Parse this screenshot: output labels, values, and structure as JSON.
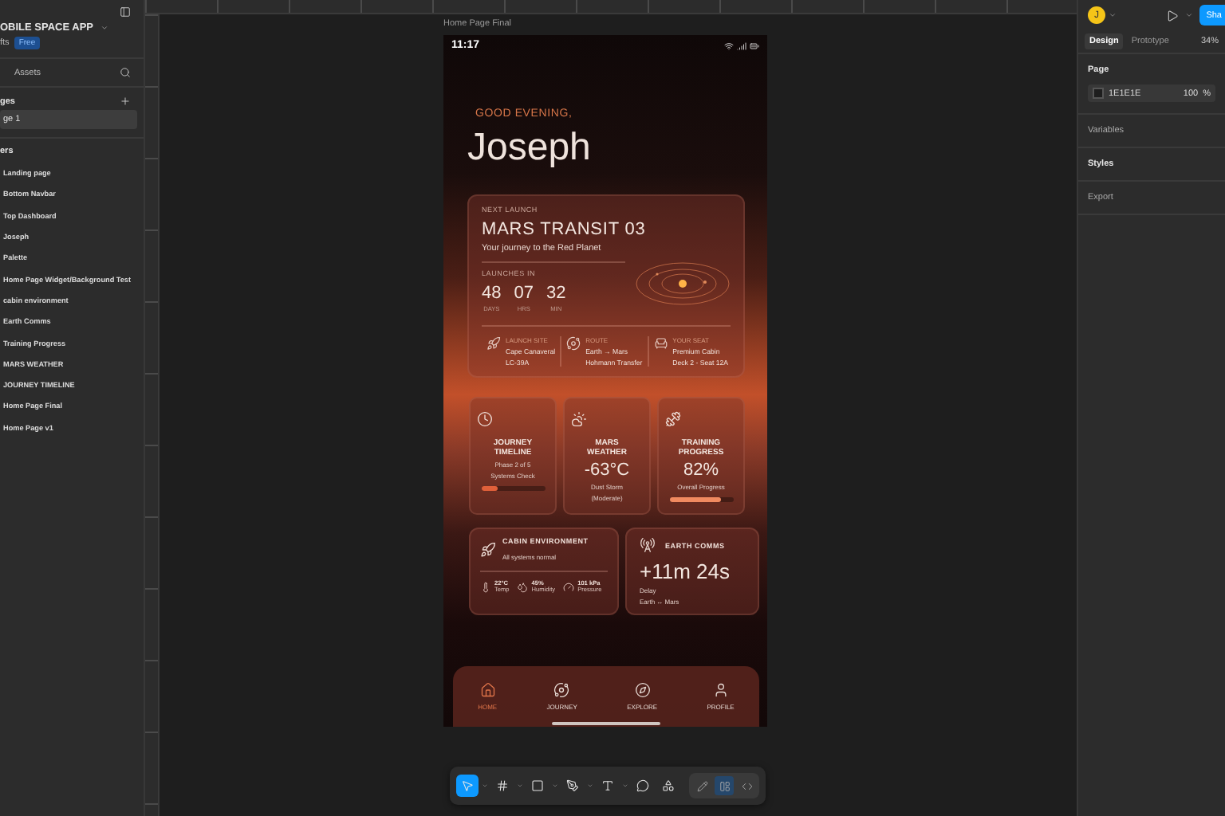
{
  "file": {
    "name": "OBILE SPACE APP",
    "team": "fts",
    "plan_badge": "Free"
  },
  "assets_tab": "Assets",
  "pages": {
    "heading": "ges",
    "items": [
      {
        "label": "ge 1",
        "selected": true
      }
    ]
  },
  "layers": {
    "heading": "ers",
    "items": [
      "Landing page",
      "Bottom Navbar",
      "Top Dashboard",
      "Joseph",
      "Palette",
      "Home Page Widget/Background Test",
      "cabin environment",
      "Earth Comms",
      "Training Progress",
      "MARS WEATHER",
      "JOURNEY TIMELINE",
      "Home Page Final",
      "Home Page v1"
    ]
  },
  "right_panel": {
    "avatar": "J",
    "share": "Sha",
    "tabs": [
      {
        "label": "Design",
        "selected": true
      },
      {
        "label": "Prototype",
        "selected": false
      }
    ],
    "zoom": "34%",
    "page_heading": "Page",
    "color_hex": "1E1E1E",
    "opacity": "100",
    "opacity_unit": "%",
    "sections": [
      "Variables",
      "Styles",
      "Export"
    ]
  },
  "frame_label": "Home Page Final",
  "phone": {
    "time": "11:17",
    "greeting": "GOOD EVENING,",
    "name": "Joseph",
    "launch": {
      "eyebrow": "NEXT LAUNCH",
      "title": "MARS TRANSIT 03",
      "subtitle": "Your journey to the Red Planet",
      "countdown_label": "LAUNCHES IN",
      "countdown": [
        {
          "value": "48",
          "unit": "DAYS"
        },
        {
          "value": "07",
          "unit": "HRS"
        },
        {
          "value": "32",
          "unit": "MIN"
        }
      ],
      "details": [
        {
          "kind": "site",
          "label": "LAUNCH SITE",
          "line1": "Cape Canaveral",
          "line2": "LC-39A"
        },
        {
          "kind": "route",
          "label": "ROUTE",
          "line1": "Earth → Mars",
          "line2": "Hohmann Transfer"
        },
        {
          "kind": "seat",
          "label": "YOUR SEAT",
          "line1": "Premium Cabin",
          "line2": "Deck 2 - Seat 12A"
        }
      ]
    },
    "widgets": [
      {
        "kind": "timeline",
        "title": "JOURNEY TIMELINE",
        "lines": [
          "Phase 2 of 5",
          "Systems Check"
        ],
        "level": 0.25
      },
      {
        "kind": "weather",
        "title": "MARS WEATHER",
        "value": "-63°C",
        "lines": [
          "Dust Storm",
          "(Moderate)"
        ]
      },
      {
        "kind": "training",
        "title": "TRAINING PROGRESS",
        "value": "82%",
        "lines": [
          "Overall Progress"
        ],
        "level": 0.82
      }
    ],
    "cabin": {
      "title": "CABIN ENVIRONMENT",
      "status": "All systems normal",
      "stats": [
        {
          "kind": "temp",
          "value": "22°C",
          "label": "Temp"
        },
        {
          "kind": "humidity",
          "value": "45%",
          "label": "Humidity"
        },
        {
          "kind": "pressure",
          "value": "101 kPa",
          "label": "Pressure"
        }
      ]
    },
    "comms": {
      "title": "EARTH COMMS",
      "value": "+11m 24s",
      "lines": [
        "Delay",
        "Earth ↔ Mars"
      ]
    },
    "nav": [
      {
        "kind": "home",
        "label": "HOME",
        "selected": true
      },
      {
        "kind": "journey",
        "label": "JOURNEY",
        "selected": false
      },
      {
        "kind": "explore",
        "label": "EXPLORE",
        "selected": false
      },
      {
        "kind": "profile",
        "label": "PROFILE",
        "selected": false
      }
    ]
  },
  "toolbar": {
    "tools": [
      {
        "kind": "move",
        "selected": true
      },
      {
        "kind": "frame",
        "selected": false
      },
      {
        "kind": "rect",
        "selected": false
      },
      {
        "kind": "pen",
        "selected": false
      },
      {
        "kind": "text",
        "selected": false
      },
      {
        "kind": "comment",
        "selected": false
      },
      {
        "kind": "components",
        "selected": false
      }
    ],
    "modes": [
      {
        "kind": "draw",
        "selected": false
      },
      {
        "kind": "design",
        "selected": true
      },
      {
        "kind": "dev",
        "selected": false
      }
    ]
  }
}
